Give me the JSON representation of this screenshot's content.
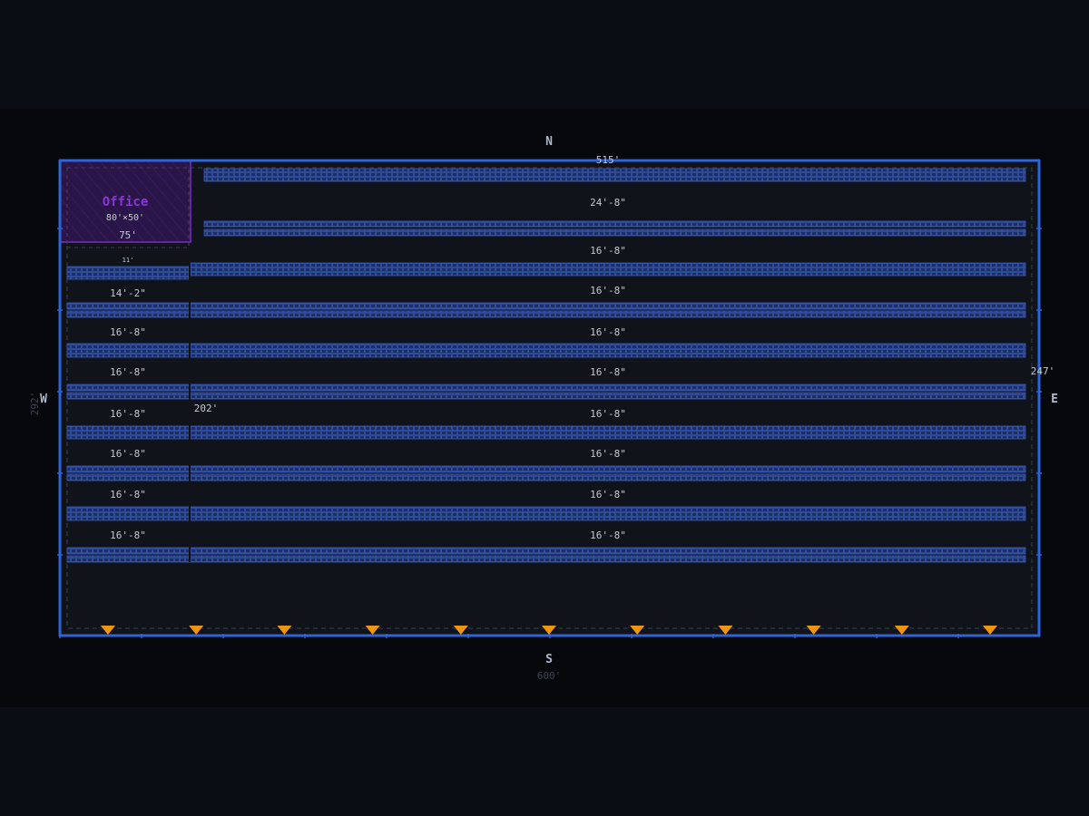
{
  "compass": {
    "north": "N",
    "south": "S",
    "east": "E",
    "west": "W"
  },
  "dimensions": {
    "north_length": "515'",
    "south_length": "600'",
    "west_length": "292'",
    "east_length": "247'",
    "office_aisle": "75'",
    "small_gap": "11'",
    "mid_label": "202'"
  },
  "office": {
    "title": "Office",
    "size": "80'×50'"
  },
  "aisles_right": [
    "24'-8\"",
    "16'-8\"",
    "16'-8\"",
    "16'-8\"",
    "16'-8\"",
    "16'-8\"",
    "16'-8\"",
    "16'-8\"",
    "16'-8\""
  ],
  "aisles_left": [
    "14'-2\"",
    "16'-8\"",
    "16'-8\"",
    "16'-8\"",
    "16'-8\"",
    "16'-8\"",
    "16'-8\""
  ],
  "dock_doors": {
    "count": 11
  },
  "colors": {
    "wall": "#2f63d6",
    "rack_fill": "#1c2f63",
    "rack_stroke": "#3b5bbd",
    "office": "#7a2bc6",
    "dock": "#f0950f",
    "text": "#c3c8d2"
  }
}
